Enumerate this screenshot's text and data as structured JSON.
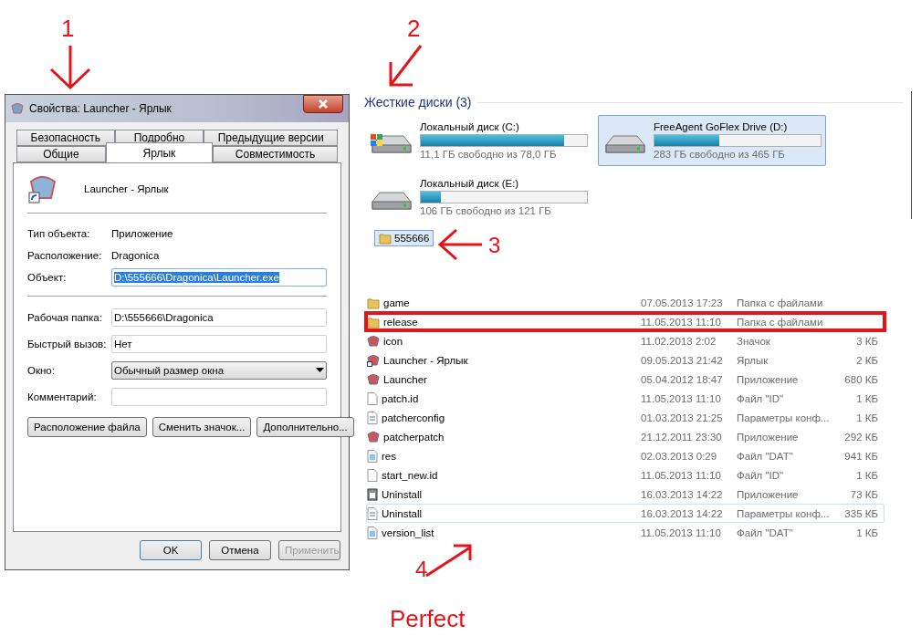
{
  "annotations": [
    {
      "kind": "number",
      "text": "1"
    },
    {
      "kind": "number",
      "text": "2"
    },
    {
      "kind": "number",
      "text": "3"
    },
    {
      "kind": "number",
      "text": "4"
    },
    {
      "kind": "caption",
      "text": "Perfect"
    }
  ],
  "dialog": {
    "title": "Свойства: Launcher - Ярлык",
    "tab_rows": [
      {
        "tabs": [
          {
            "label": "Безопасность",
            "selected": false
          },
          {
            "label": "Подробно",
            "selected": false
          },
          {
            "label": "Предыдущие версии",
            "selected": false
          }
        ]
      },
      {
        "tabs": [
          {
            "label": "Общие",
            "selected": false
          },
          {
            "label": "Ярлык",
            "selected": true
          },
          {
            "label": "Совместимость",
            "selected": false
          }
        ]
      }
    ],
    "item_name": "Launcher - Ярлык",
    "info": [
      {
        "label": "Тип объекта:",
        "value": "Приложение"
      },
      {
        "label": "Расположение:",
        "value": "Dragonica"
      }
    ],
    "target": {
      "label": "Объект:",
      "value": "D:\\555666\\Dragonica\\Launcher.exe",
      "highlighted": true
    },
    "fields": [
      {
        "kind": "input",
        "label": "Рабочая папка:",
        "value": "D:\\555666\\Dragonica"
      },
      {
        "kind": "input",
        "label": "Быстрый вызов:",
        "value": "Нет"
      },
      {
        "kind": "select",
        "label": "Окно:",
        "value": "Обычный размер окна"
      },
      {
        "kind": "input",
        "label": "Комментарий:"
      }
    ],
    "actions": [
      "Расположение файла",
      "Сменить значок...",
      "Дополнительно..."
    ],
    "footer_buttons": [
      {
        "label": "OK",
        "default": true,
        "disabled": false
      },
      {
        "label": "Отмена",
        "default": false,
        "disabled": false
      },
      {
        "label": "Применить",
        "default": false,
        "disabled": true
      }
    ]
  },
  "drives": {
    "group_title": "Жесткие диски (3)",
    "items": [
      {
        "kind": "system",
        "name": "Локальный диск (C:)",
        "free": "11,1 ГБ свободно из 78,0 ГБ",
        "level": 0.86,
        "selected": false
      },
      {
        "kind": "disk",
        "name": "FreeAgent GoFlex Drive (D:)",
        "free": "283 ГБ свободно из 465 ГБ",
        "level": 0.39,
        "selected": true
      },
      {
        "kind": "disk",
        "name": "Локальный диск (E:)",
        "free": "106 ГБ свободно из 121 ГБ",
        "level": 0.12,
        "selected": false
      }
    ]
  },
  "folders": [
    {
      "name": "555666",
      "selected": true
    }
  ],
  "files": [
    {
      "kind": "folder",
      "name": "game",
      "date": "07.05.2013 17:23",
      "type": "Папка с файлами",
      "marked": false,
      "hovered": false
    },
    {
      "kind": "folder",
      "name": "release",
      "date": "11.05.2013 11:10",
      "type": "Папка с файлами",
      "marked": true,
      "hovered": false
    },
    {
      "kind": "app",
      "name": "icon",
      "date": "11.02.2013 2:02",
      "type": "Значок",
      "size": "3 КБ",
      "marked": false,
      "hovered": false
    },
    {
      "kind": "shortcut",
      "name": "Launcher - Ярлык",
      "date": "09.05.2013 21:42",
      "type": "Ярлык",
      "size": "2 КБ",
      "marked": false,
      "hovered": false
    },
    {
      "kind": "app",
      "name": "Launcher",
      "date": "05.04.2012 18:47",
      "type": "Приложение",
      "size": "680 КБ",
      "marked": false,
      "hovered": false
    },
    {
      "kind": "blank",
      "name": "patch.id",
      "date": "11.05.2013 11:10",
      "type": "Файл \"ID\"",
      "size": "1 КБ",
      "marked": false,
      "hovered": false
    },
    {
      "kind": "config",
      "name": "patcherconfig",
      "date": "01.03.2013 21:25",
      "type": "Параметры конф...",
      "size": "1 КБ",
      "marked": false,
      "hovered": false
    },
    {
      "kind": "app",
      "name": "patcherpatch",
      "date": "21.12.2011 23:30",
      "type": "Приложение",
      "size": "292 КБ",
      "marked": false,
      "hovered": false
    },
    {
      "kind": "data",
      "name": "res",
      "date": "02.03.2013 0:29",
      "type": "Файл \"DAT\"",
      "size": "941 КБ",
      "marked": false,
      "hovered": false
    },
    {
      "kind": "blank",
      "name": "start_new.id",
      "date": "11.05.2013 11:10",
      "type": "Файл \"ID\"",
      "size": "1 КБ",
      "marked": false,
      "hovered": false
    },
    {
      "kind": "installer",
      "name": "Uninstall",
      "date": "16.03.2013 14:22",
      "type": "Приложение",
      "size": "73 КБ",
      "marked": false,
      "hovered": false
    },
    {
      "kind": "config",
      "name": "Uninstall",
      "date": "16.03.2013 14:22",
      "type": "Параметры конф...",
      "size": "335 КБ",
      "marked": false,
      "hovered": true
    },
    {
      "kind": "data",
      "name": "version_list",
      "date": "11.05.2013 11:10",
      "type": "Файл \"DAT\"",
      "size": "1 КБ",
      "marked": false,
      "hovered": false
    }
  ]
}
